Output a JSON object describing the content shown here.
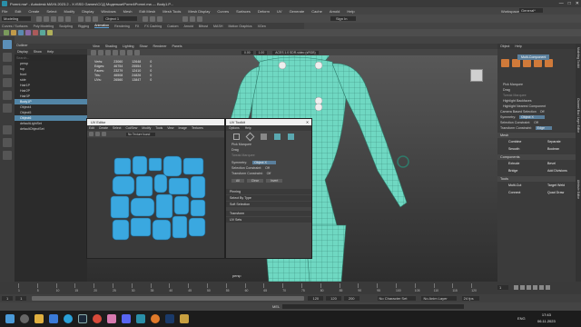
{
  "window": {
    "title": "Pomni.ma* - Autodesk MAYA 2023.2 - X:\\SSD Games\\ССД Модельки\\Pomni\\Pomni.ma --- Body1.P...",
    "controls": [
      "—",
      "□",
      "✕"
    ]
  },
  "menu": [
    "File",
    "Edit",
    "Create",
    "Select",
    "Modify",
    "Display",
    "Windows",
    "Mesh",
    "Edit Mesh",
    "Mesh Tools",
    "Mesh Display",
    "Curves",
    "Surfaces",
    "Deform",
    "UV",
    "Generate",
    "Cache",
    "Arnold",
    "Help"
  ],
  "workspace": {
    "label": "Workspace:",
    "value": "General*"
  },
  "status": {
    "mode": "Modeling",
    "object": "Object 1",
    "signin": "Sign In"
  },
  "shelf_tabs": [
    "Curves / Surfaces",
    "Poly Modeling",
    "Sculpting",
    "Rigging",
    "Animation",
    "Rendering",
    "FX",
    "FX Caching",
    "Custom",
    "Arnold",
    "Bifrost",
    "MASH",
    "Motion Graphics",
    "XGen"
  ],
  "outliner": {
    "tabs": [
      "Outliner"
    ],
    "menu": [
      "Display",
      "Show",
      "Help"
    ],
    "search_placeholder": "Search...",
    "items": [
      {
        "label": "persp",
        "selected": false
      },
      {
        "label": "top",
        "selected": false
      },
      {
        "label": "front",
        "selected": false
      },
      {
        "label": "side",
        "selected": false
      },
      {
        "label": "Hair1P",
        "selected": false
      },
      {
        "label": "Hair2P",
        "selected": false
      },
      {
        "label": "Hair3P",
        "selected": false
      },
      {
        "label": "Body1P",
        "selected": true
      },
      {
        "label": "Object4",
        "selected": false
      },
      {
        "label": "Object5",
        "selected": false
      },
      {
        "label": "Object6",
        "selected": true
      },
      {
        "label": "defaultLightSet",
        "selected": false
      },
      {
        "label": "defaultObjectSet",
        "selected": false
      }
    ]
  },
  "viewport": {
    "menu": [
      "View",
      "Shading",
      "Lighting",
      "Show",
      "Renderer",
      "Panels"
    ],
    "hud": [
      {
        "label": "Verts:",
        "a": "23060",
        "b": "12648",
        "c": "0"
      },
      {
        "label": "Edges:",
        "a": "46754",
        "b": "25554",
        "c": "0"
      },
      {
        "label": "Faces:",
        "a": "23279",
        "b": "12410",
        "c": "0"
      },
      {
        "label": "Tris:",
        "a": "46508",
        "b": "24826",
        "c": "0"
      },
      {
        "label": "UVs:",
        "a": "26560",
        "b": "13847",
        "c": "0"
      }
    ],
    "camera": "persp",
    "tool_values": {
      "a": "0.00",
      "b": "1.00"
    },
    "color_space": "ACES 1.0 SDR-video (sRGB)"
  },
  "uv_editor": {
    "title": "UV Editor",
    "menu": [
      "Edit",
      "Create",
      "Select",
      "Cut/Sew",
      "Modify",
      "Tools",
      "View",
      "Image",
      "Textures"
    ],
    "texture_label": "No Texture found"
  },
  "uv_toolkit": {
    "title": "UV Toolkit",
    "menu": [
      "Options",
      "Help"
    ],
    "options": [
      "Pick Marquee",
      "Drag",
      "Tweak Marquee"
    ],
    "symmetry": {
      "label": "Symmetry:",
      "value": "Object X"
    },
    "selection_constraint": {
      "label": "Selection Constraint:",
      "value": "Off"
    },
    "transform_constraint": {
      "label": "Transform Constraint:",
      "value": "Off"
    },
    "buttons": [
      "All",
      "Clear",
      "Invert"
    ],
    "sections": [
      "Pinning",
      "Select By Type",
      "Soft Selection",
      "Transform",
      "UV Sets"
    ]
  },
  "modeling_toolkit": {
    "menu": [
      "Object",
      "Help"
    ],
    "mode_title": "Multi-Component",
    "options": [
      {
        "label": "Pick Marquee",
        "checked": true
      },
      {
        "label": "Drag",
        "checked": false
      },
      {
        "label": "Tweak Marquee",
        "checked": false
      },
      {
        "label": "Highlight Backfaces",
        "checked": true
      },
      {
        "label": "Highlight Nearest Component",
        "checked": true
      }
    ],
    "camera_selection": {
      "label": "Camera Based Selection",
      "value": "Off"
    },
    "symmetry": {
      "label": "Symmetry:",
      "value": "Object X"
    },
    "selection_constraint": {
      "label": "Selection Constraint:",
      "value": "Off"
    },
    "transform_constraint": {
      "label": "Transform Constraint:",
      "value": "Edge"
    },
    "mesh_section": "Mesh",
    "mesh_buttons": [
      "Combine",
      "Separate",
      "Smooth",
      "Boolean"
    ],
    "components_section": "Components",
    "component_buttons": [
      "Extrude",
      "Bevel",
      "Bridge",
      "Add Divisions"
    ],
    "tools_section": "Tools",
    "tool_buttons": [
      "Multi-Cut",
      "Target Weld",
      "Connect",
      "Quad Draw"
    ],
    "side_tabs": [
      "Modeling Toolkit",
      "Channel Box / Layer Editor",
      "Attribute Editor"
    ]
  },
  "timeline": {
    "ticks": [
      "1",
      "5",
      "10",
      "15",
      "20",
      "25",
      "30",
      "35",
      "40",
      "45",
      "50",
      "55",
      "60",
      "65",
      "70",
      "75",
      "80",
      "85",
      "90",
      "95",
      "100",
      "105",
      "110",
      "115",
      "120"
    ],
    "current_frame": "1",
    "range": {
      "start": "1",
      "start2": "1",
      "end": "120",
      "end2": "120",
      "end3": "200"
    },
    "character_set": "No Character Set",
    "anim_layer": "No Anim Layer",
    "fps": "24 fps"
  },
  "command_line": {
    "label": "MEL"
  },
  "taskbar": {
    "time": "17:43",
    "date": "06.11.2023",
    "lang": "ENG",
    "icons": [
      "start-icon",
      "search-icon",
      "explorer-icon",
      "browser-icon",
      "telegram-icon",
      "steam-icon",
      "chrome-icon",
      "paint-icon",
      "discord-icon",
      "maya-icon",
      "blender-icon",
      "photoshop-icon",
      "folder-icon"
    ]
  },
  "colors": {
    "accent": "#5285a6",
    "mesh": "#6fe0c8",
    "uv": "#3aa8e0",
    "button": "#5a7f9c"
  }
}
